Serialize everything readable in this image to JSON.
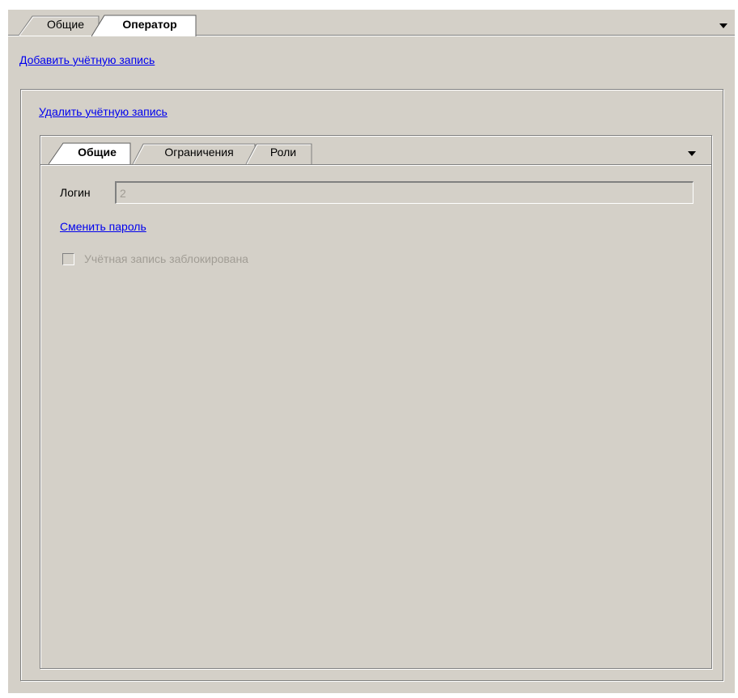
{
  "outer_tabs": [
    {
      "label": "Общие",
      "active": false
    },
    {
      "label": "Оператор",
      "active": true
    }
  ],
  "actions": {
    "add_account": "Добавить учётную запись",
    "delete_account": "Удалить учётную запись"
  },
  "inner_tabs": [
    {
      "label": "Общие",
      "active": true
    },
    {
      "label": "Ограничения",
      "active": false
    },
    {
      "label": "Роли",
      "active": false
    }
  ],
  "form": {
    "login_label": "Логин",
    "login_value": "2",
    "change_password": "Сменить пароль",
    "locked_label": "Учётная запись заблокирована",
    "locked_checked": false
  },
  "icons": {
    "outer_menu": "chevron-down-icon",
    "inner_menu": "chevron-down-icon"
  },
  "colors": {
    "background": "#d4d0c8",
    "link": "#0000ee",
    "disabled_text": "#a19d95"
  }
}
